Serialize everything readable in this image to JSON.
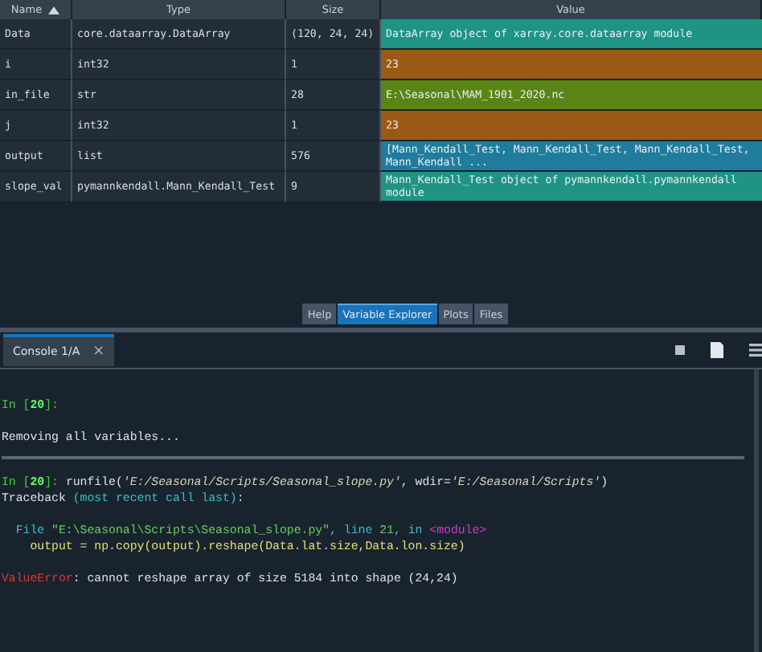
{
  "variable_explorer": {
    "columns": [
      "Name",
      "Type",
      "Size",
      "Value"
    ],
    "rows": [
      {
        "name": "Data",
        "type": "core.dataarray.DataArray",
        "size": "(120, 24, 24)",
        "value": "DataArray object of xarray.core.dataarray module",
        "color": "#1f9484"
      },
      {
        "name": "i",
        "type": "int32",
        "size": "1",
        "value": "23",
        "color": "#9a5a16"
      },
      {
        "name": "in_file",
        "type": "str",
        "size": "28",
        "value": "E:\\Seasonal\\MAM_1901_2020.nc",
        "color": "#5a8416"
      },
      {
        "name": "j",
        "type": "int32",
        "size": "1",
        "value": "23",
        "color": "#9a5a16"
      },
      {
        "name": "output",
        "type": "list",
        "size": "576",
        "value": "[Mann_Kendall_Test, Mann_Kendall_Test, Mann_Kendall_Test, Mann_Kendall ...",
        "color": "#1f7c9c"
      },
      {
        "name": "slope_val",
        "type": "pymannkendall.Mann_Kendall_Test",
        "size": "9",
        "value": "Mann_Kendall_Test object of pymannkendall.pymannkendall module",
        "color": "#1f9484"
      }
    ]
  },
  "pane_tabs": [
    {
      "label": "Help",
      "selected": false
    },
    {
      "label": "Variable Explorer",
      "selected": true
    },
    {
      "label": "Plots",
      "selected": false
    },
    {
      "label": "Files",
      "selected": false
    }
  ],
  "console": {
    "tab": {
      "label": "Console 1/A",
      "close": "×"
    },
    "blocks": [
      {
        "kind": "output",
        "lines": [
          [
            {
              "kind": "prompt",
              "text": "In ["
            },
            {
              "kind": "prompt-number",
              "text": "20"
            },
            {
              "kind": "prompt",
              "text": "]:"
            }
          ]
        ]
      },
      {
        "kind": "output",
        "lines": [
          [
            {
              "kind": "plain",
              "text": "Removing all variables..."
            }
          ]
        ]
      },
      {
        "kind": "divider"
      },
      {
        "kind": "output",
        "lines": [
          [
            {
              "kind": "prompt",
              "text": "In ["
            },
            {
              "kind": "prompt-number",
              "text": "20"
            },
            {
              "kind": "prompt",
              "text": "]: "
            },
            {
              "kind": "plain",
              "text": "runfile("
            },
            {
              "kind": "string",
              "text": "'E:/Seasonal/Scripts/Seasonal_slope.py'"
            },
            {
              "kind": "plain",
              "text": ", wdir="
            },
            {
              "kind": "string",
              "text": "'E:/Seasonal/Scripts'"
            },
            {
              "kind": "plain",
              "text": ")"
            }
          ],
          [
            {
              "kind": "plain",
              "text": "Traceback "
            },
            {
              "kind": "cyan",
              "text": "(most recent call last)"
            },
            {
              "kind": "plain",
              "text": ":"
            }
          ]
        ]
      },
      {
        "kind": "output",
        "lines": [
          [
            {
              "kind": "cyan",
              "text": "  File "
            },
            {
              "kind": "green",
              "text": "\"E:\\Seasonal\\Scripts\\Seasonal_slope.py\""
            },
            {
              "kind": "cyan",
              "text": ", line "
            },
            {
              "kind": "green",
              "text": "21"
            },
            {
              "kind": "cyan",
              "text": ", in "
            },
            {
              "kind": "magenta",
              "text": "<module>"
            }
          ],
          [
            {
              "kind": "yellow",
              "text": "    output = np.copy(output).reshape(Data.lat.size,Data.lon.size)"
            }
          ]
        ]
      },
      {
        "kind": "output",
        "lines": [
          [
            {
              "kind": "error",
              "text": "ValueError"
            },
            {
              "kind": "plain",
              "text": ": cannot reshape array of size 5184 into shape (24,24)"
            }
          ]
        ]
      }
    ]
  }
}
